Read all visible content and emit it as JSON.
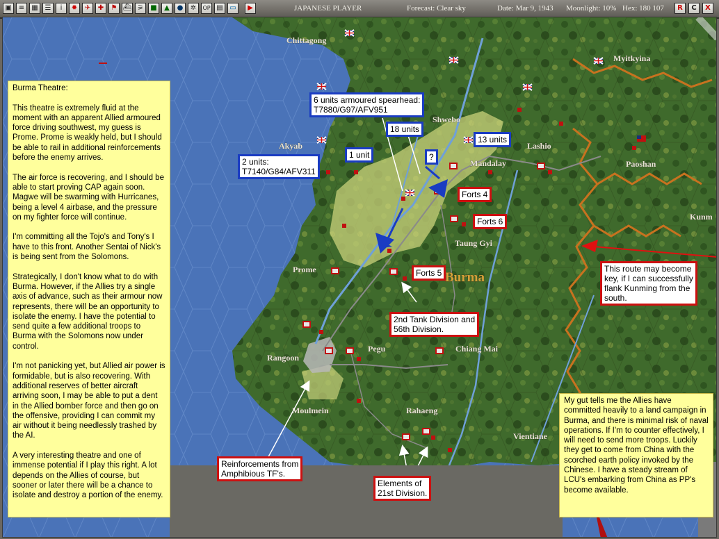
{
  "toolbar": {
    "buttons": [
      "menu",
      "report",
      "group",
      "list",
      "info",
      "japan-flag",
      "aircraft",
      "torpedo",
      "flag",
      "ship",
      "chart",
      "supply",
      "base",
      "globe",
      "op",
      "grid",
      "screen",
      "play"
    ],
    "player": "JAPANESE PLAYER",
    "forecast": "Forecast: Clear sky",
    "date": "Date: Mar 9, 1943",
    "moonlight": "Moonlight: 10%",
    "hex": "Hex: 180 107",
    "right_buttons": [
      "R",
      "C",
      "X"
    ]
  },
  "map": {
    "region_label": "Burma",
    "towns": [
      "Chittagong",
      "Myitkyina",
      "Shwebo",
      "Akyab",
      "Lashio",
      "Mandalay",
      "Paoshan",
      "Taung Gyi",
      "Prome",
      "Kunm",
      "Pegu",
      "Chiang Mai",
      "Rangoon",
      "Moulmein",
      "Rahaeng",
      "Vientiane"
    ]
  },
  "notes": {
    "burma_theatre": "Burma Theatre:\n\nThis theatre is extremely fluid at the moment with an apparent Allied armoured force driving southwest, my guess is Prome. Prome is weakly held, but I should be able to rail in additional reinforcements before the enemy arrives.\n\nThe air force is recovering, and I should be able to start proving CAP again soon. Magwe will be swarming with Hurricanes, being a level 4 airbase, and the pressure on my fighter force will continue.\n\nI'm committing all the Tojo's and Tony's I have to this front. Another Sentai of Nick's is being sent from the Solomons.\n\nStrategically, I don't know what to do with Burma. However, if the Allies try a single axis of advance, such as their armour now represents, there will be an opportunity to isolate the enemy. I have the potential to send quite a few additional troops to Burma with the Solomons now under control.\n\nI'm not panicking yet, but Allied air power is formidable, but is also recovering. With additional reserves of better aircraft arriving soon, I may be able to put a dent in the Allied bomber force and then go on the offensive, providing I can commit my air without it being needlessly trashed by the AI.\n\nA very interesting theatre and one of immense potential if I play this right. A lot depends on the Allies of course, but sooner or later there will be a chance to isolate and destroy a portion of the enemy.",
    "gut_feeling": "My gut tells me the Allies have committed heavily to a land campaign in Burma, and there is minimal risk of naval operations. If I'm to counter effectively, I will need to send more troops. Luckily they get to come from China with the scorched earth policy invoked by the Chinese. I have a steady stream of LCU's embarking from China as PP's become available."
  },
  "labels": {
    "spearhead": "6 units armoured spearhead:\nT7880/G97/AFV951",
    "two_units": "2 units:\nT7140/G84/AFV311",
    "one_unit": "1 unit",
    "eighteen_units": "18 units",
    "thirteen_units": "13 units",
    "question": "?",
    "forts4": "Forts 4",
    "forts6": "Forts 6",
    "forts5": "Forts 5",
    "tank_division": "2nd Tank Division and\n56th Division.",
    "route": "This route may become\nkey, if I can successfully\nflank Kunming from the\nsouth.",
    "reinforcements": "Reinforcements from\nAmphibious TF's.",
    "elements": "Elements of\n21st Division."
  },
  "colors": {
    "sea": "#4a73b8",
    "land": "#3f6a2c",
    "hex_border": "#c8721f",
    "allied_zone": "#c9d27a",
    "blue_box": "#1a3cc2",
    "red_box": "#cc1010",
    "note_yellow": "#ffff9c"
  }
}
